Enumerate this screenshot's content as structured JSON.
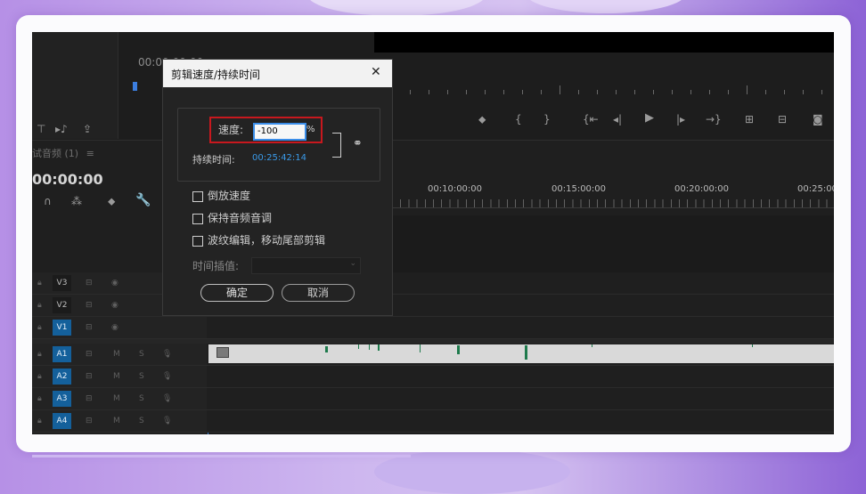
{
  "dialog": {
    "title": "剪辑速度/持续时间",
    "close_glyph": "✕",
    "speed_label": "速度:",
    "speed_value": "-100",
    "speed_unit": "%",
    "duration_label": "持续时间:",
    "duration_value": "00:25:42:14",
    "checkboxes": [
      "倒放速度",
      "保持音频音调",
      "波纹编辑，移动尾部剪辑"
    ],
    "interp_label": "时间插值:",
    "ok_label": "确定",
    "cancel_label": "取消"
  },
  "program_monitor": {
    "timecode": "00:00:00:00"
  },
  "timeline": {
    "sequence_name": "试音频 (1)",
    "sequence_menu": "≡",
    "timecode": "00:00:00",
    "ruler": [
      "00:10:00:00",
      "00:15:00:00",
      "00:20:00:00",
      "00:25:00"
    ],
    "video_tracks": [
      "V3",
      "V2",
      "V1"
    ],
    "audio_tracks": [
      "A1",
      "A2",
      "A3",
      "A4"
    ],
    "track_m": "M",
    "track_s": "S"
  },
  "colors": {
    "highlight_box": "#c8181e",
    "input_focus": "#3b8ee9",
    "timecode_blue": "#3a9ae8",
    "track_selected": "#14609b",
    "waveform_green": "#1e7a4c"
  }
}
